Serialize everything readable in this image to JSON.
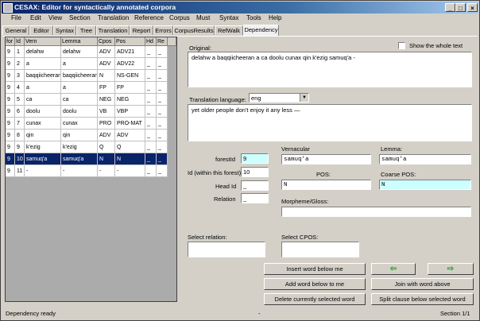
{
  "window": {
    "title": "CESAX: Editor for syntactically annotated corpora",
    "min": "_",
    "max": "□",
    "close": "×"
  },
  "menu": [
    "File",
    "Edit",
    "View",
    "Section",
    "Translation",
    "Reference",
    "Corpus",
    "Must",
    "Syntax",
    "Tools",
    "Help"
  ],
  "tabs": [
    "General",
    "Editor",
    "Syntax",
    "Tree",
    "Translation",
    "Report",
    "Errors",
    "CorpusResults",
    "RefWalk",
    "Dependency"
  ],
  "active_tab": "Dependency",
  "grid": {
    "columns": [
      "for",
      "Id",
      "Vern",
      "Lemma",
      "Cpos",
      "Pos",
      "Hd",
      "Re"
    ],
    "rows": [
      [
        "9",
        "1",
        "delahw",
        "delahw",
        "ADV",
        "ADV21",
        "_",
        "_"
      ],
      [
        "9",
        "2",
        "a",
        "a",
        "ADV",
        "ADV22",
        "_",
        "_"
      ],
      [
        "9",
        "3",
        "baqqiicheeran",
        "baqqiicheeran",
        "N",
        "NS-GEN",
        "_",
        "_"
      ],
      [
        "9",
        "4",
        "a",
        "a",
        "FP",
        "FP",
        "_",
        "_"
      ],
      [
        "9",
        "5",
        "ca",
        "ca",
        "NEG",
        "NEG",
        "_",
        "_"
      ],
      [
        "9",
        "6",
        "doolu",
        "doolu",
        "VB",
        "VBP",
        "_",
        "_"
      ],
      [
        "9",
        "7",
        "cunax",
        "cunax",
        "PRO",
        "PRO-MAT",
        "_",
        "_"
      ],
      [
        "9",
        "8",
        "qin",
        "qin",
        "ADV",
        "ADV",
        "_",
        "_"
      ],
      [
        "9",
        "9",
        "k'ezig",
        "k'ezig",
        "Q",
        "Q",
        "_",
        "_"
      ],
      [
        "9",
        "10",
        "samuq'a",
        "samuq'a",
        "N",
        "N",
        "_",
        "_"
      ],
      [
        "9",
        "11",
        "-",
        "-",
        "-",
        "-",
        "_",
        "_"
      ]
    ],
    "selected_row": 9
  },
  "original": {
    "label": "Original:",
    "text": "delahw a baqqiicheeran a ca doolu cunax qin k'ezig samuq'a -",
    "show_whole_text_label": "Show the whole text",
    "show_whole_text_checked": false
  },
  "translation": {
    "label": "Translation language:",
    "language": "eng",
    "text": "yet older people don't enjoy it any less —"
  },
  "fields": {
    "forestId_label": "forestId",
    "forestId": "9",
    "id_label": "Id (within this forest)",
    "id": "10",
    "headId_label": "Head Id",
    "headId": "_",
    "relation_label": "Relation",
    "relation": "_",
    "vernacular_label": "Vernacular",
    "vernacular": "samuq'a",
    "lemma_label": "Lemma:",
    "lemma": "samuq'a",
    "pos_label": "POS:",
    "pos": "N",
    "cpos_label": "Coarse POS:",
    "cpos": "N",
    "morpheme_label": "Morpheme/Gloss:",
    "morpheme": "",
    "select_relation_label": "Select relation:",
    "select_relation": "",
    "select_cpos_label": "Select CPOS:",
    "select_cpos": ""
  },
  "buttons": {
    "insert_below": "Insert word below me",
    "add_below": "Add word below to me",
    "delete_selected": "Delete currently selected word",
    "join_above": "Join with word above",
    "split_clause": "Split clause below selected word",
    "prev_arrow": "⇦",
    "next_arrow": "⇨"
  },
  "status": {
    "left": "Dependency ready",
    "middle": "-",
    "right": "Section 1/1"
  },
  "colors": {
    "title_start": "#0a246a",
    "selection": "#0a246a",
    "cyan_field": "#ccffff",
    "arrow_green": "#22a022"
  }
}
